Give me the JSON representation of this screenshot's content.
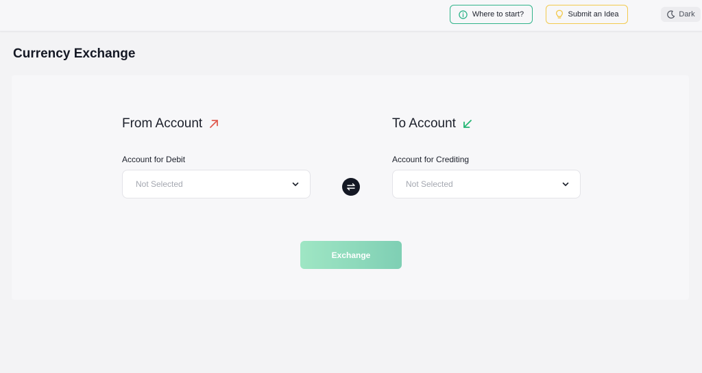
{
  "header": {
    "where_to_start_label": "Where to start?",
    "submit_idea_label": "Submit an Idea",
    "theme_toggle_label": "Dark"
  },
  "page": {
    "title": "Currency Exchange"
  },
  "from": {
    "title": "From Account",
    "field_label": "Account for Debit",
    "select_value": "Not Selected"
  },
  "to": {
    "title": "To Account",
    "field_label": "Account for Crediting",
    "select_value": "Not Selected"
  },
  "actions": {
    "exchange_label": "Exchange"
  },
  "icons": {
    "info": "info-circle-icon",
    "idea": "lightbulb-icon",
    "theme": "moon-icon",
    "from_arrow": "arrow-up-right-icon",
    "to_arrow": "arrow-down-left-icon",
    "swap": "swap-arrows-icon",
    "chevron": "chevron-down-icon"
  },
  "colors": {
    "accent_green": "#2fb389",
    "accent_yellow": "#f2c94c",
    "from_arrow": "#e05a4f",
    "to_arrow": "#22b573",
    "exchange_start": "#9fe6c4",
    "exchange_end": "#7fcfb4",
    "dark": "#141824"
  }
}
